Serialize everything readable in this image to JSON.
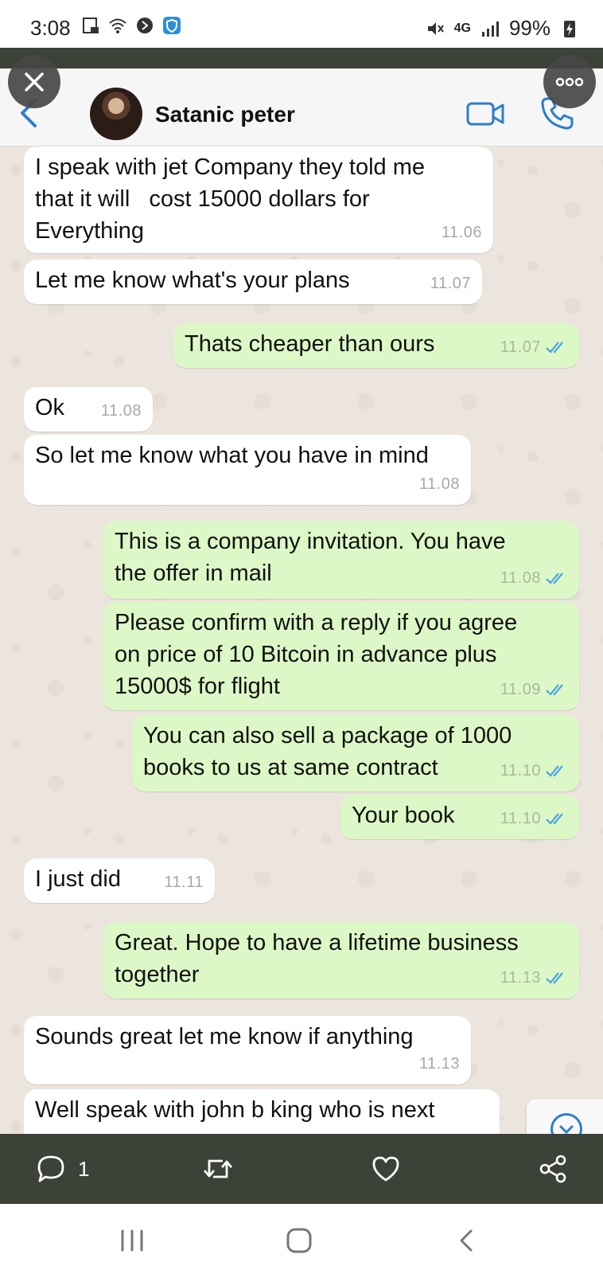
{
  "status_bar": {
    "time": "3:08",
    "network": "4G",
    "battery": "99%"
  },
  "header": {
    "contact_name": "Satanic peter"
  },
  "messages": [
    {
      "dir": "in",
      "text": "I speak with jet Company they told me\nthat it will   cost 15000 dollars for\nEverything",
      "time": "11.06"
    },
    {
      "dir": "in",
      "text": "Let me know what's your plans",
      "time": "11.07"
    },
    {
      "dir": "out",
      "text": "Thats cheaper than ours",
      "time": "11.07"
    },
    {
      "dir": "in",
      "text": "Ok",
      "time": "11.08"
    },
    {
      "dir": "in",
      "text": "So let me know what you have in mind",
      "time": "11.08"
    },
    {
      "dir": "out",
      "text": "This is a company invitation. You have\nthe offer in mail",
      "time": "11.08"
    },
    {
      "dir": "out",
      "text": "Please confirm with a reply if you agree\non price of 10 Bitcoin in advance plus\n15000$ for flight",
      "time": "11.09"
    },
    {
      "dir": "out",
      "text": "You can also sell a package of 1000\nbooks to us at same contract",
      "time": "11.10"
    },
    {
      "dir": "out",
      "text": "Your book",
      "time": "11.10"
    },
    {
      "dir": "in",
      "text": "I just did",
      "time": "11.11"
    },
    {
      "dir": "out",
      "text": "Great. Hope to have a lifetime business\ntogether",
      "time": "11.13"
    },
    {
      "dir": "in",
      "text": "Sounds great let me know if anything",
      "time": "11.13"
    },
    {
      "dir": "in",
      "text": "Well speak with john b king who is next",
      "time": ""
    }
  ],
  "action_bar": {
    "reply_count": "1"
  },
  "colors": {
    "incoming": "#ffffff",
    "outgoing": "#dcf8c6",
    "accent": "#2d7ec9",
    "chat_bg": "#ece5dd",
    "bar": "#3d4238"
  }
}
